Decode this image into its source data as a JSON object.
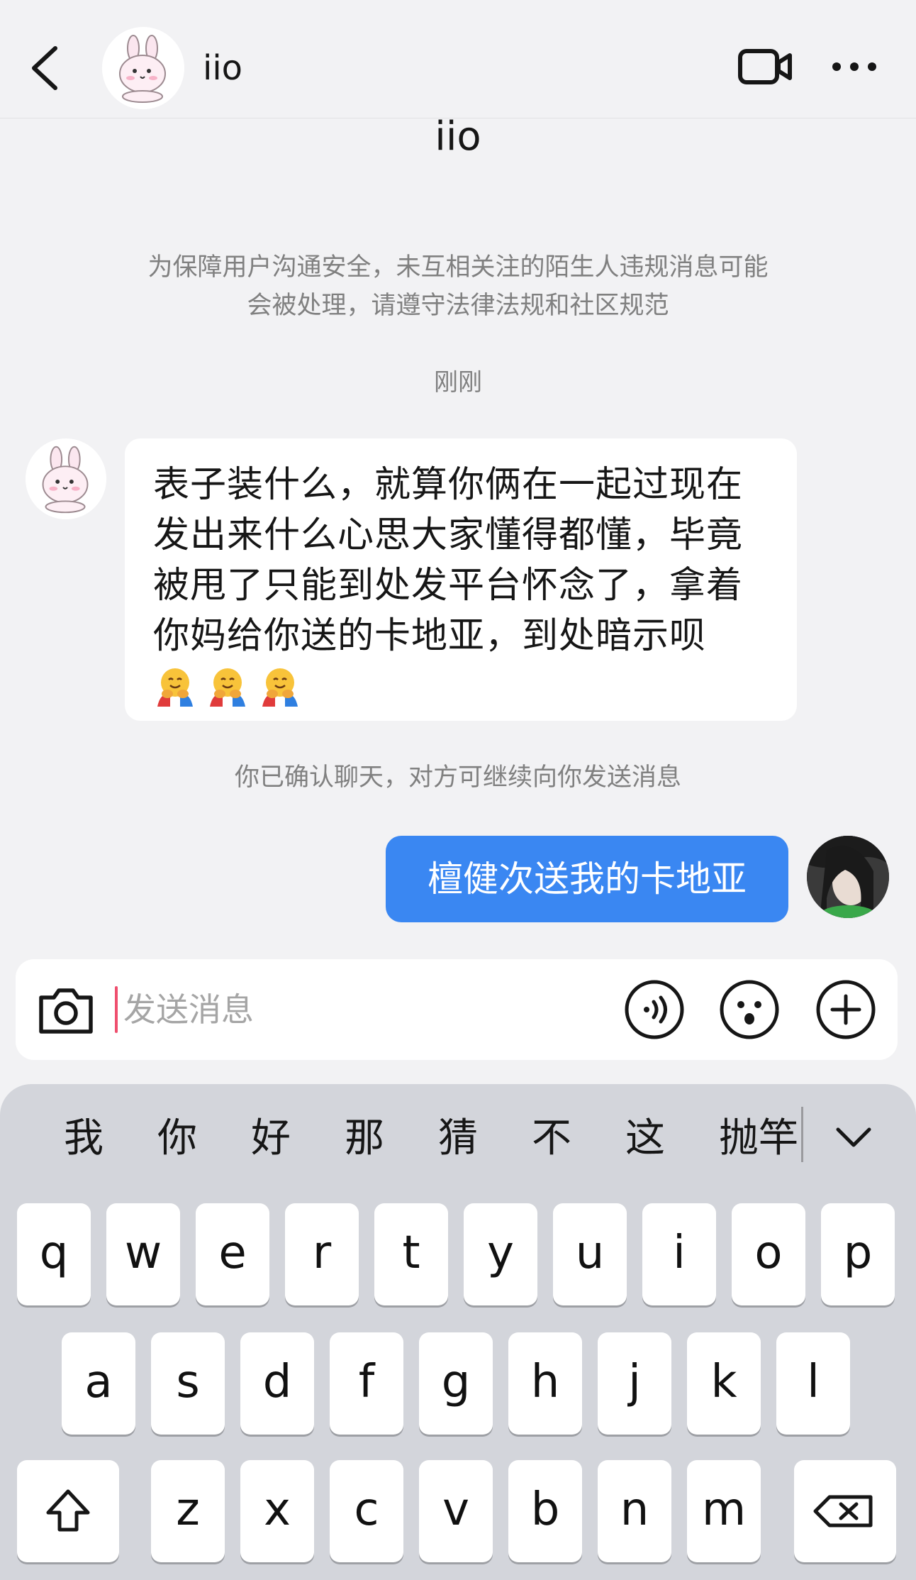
{
  "header": {
    "contact_name": "iio",
    "icons": {
      "back": "chevron-left-icon",
      "video": "video-call-icon",
      "more": "more-dots-icon"
    }
  },
  "chat": {
    "title_name": "iio",
    "safety_note_line1": "为保障用户沟通安全，未互相关注的陌生人违规消息可能",
    "safety_note_line2": "会被处理，请遵守法律法规和社区规范",
    "timestamp": "刚刚",
    "incoming_message": {
      "lines": [
        "表子装什么，就算你俩在一起过现在",
        "发出来什么心思大家懂得都懂，毕竟",
        "被甩了只能到处发平台怀念了，拿着",
        "你妈给你送的卡地亚，到处暗示呗"
      ],
      "emoji": "hugging-face-emoji",
      "emoji_count": 3
    },
    "confirm_note": "你已确认聊天，对方可继续向你发送消息",
    "outgoing_message": {
      "text": "檀健次送我的卡地亚",
      "bubble_color": "#3a87f2"
    }
  },
  "composer": {
    "placeholder": "发送消息",
    "icons": {
      "camera": "camera-icon",
      "voice": "voice-icon",
      "emoji": "emoji-face-icon",
      "plus": "plus-icon"
    }
  },
  "keyboard": {
    "candidates": [
      "我",
      "你",
      "好",
      "那",
      "猜",
      "不",
      "这",
      "抛竿"
    ],
    "row1": [
      "q",
      "w",
      "e",
      "r",
      "t",
      "y",
      "u",
      "i",
      "o",
      "p"
    ],
    "row2": [
      "a",
      "s",
      "d",
      "f",
      "g",
      "h",
      "j",
      "k",
      "l"
    ],
    "row3": [
      "z",
      "x",
      "c",
      "v",
      "b",
      "n",
      "m"
    ],
    "icons": {
      "shift": "shift-arrow-icon",
      "delete": "backspace-icon",
      "collapse": "chevron-down-icon"
    }
  },
  "colors": {
    "background": "#f2f2f4",
    "accent": "#3a87f2",
    "caret": "#ef4f6e"
  }
}
